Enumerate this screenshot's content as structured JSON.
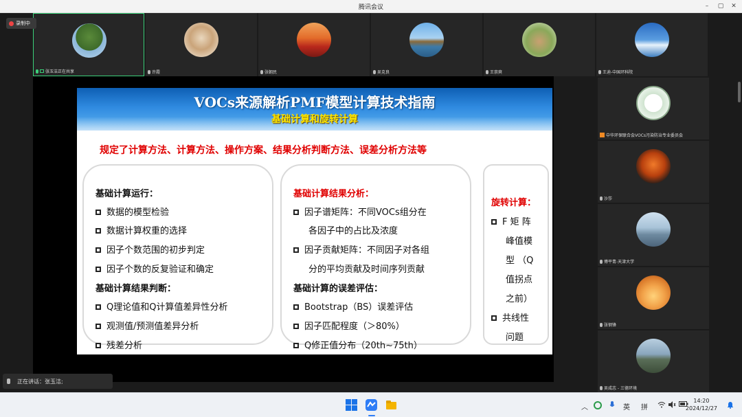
{
  "window": {
    "title": "腾讯会议",
    "minimize": "–",
    "maximize": "▢",
    "close": "✕"
  },
  "recording": {
    "label": "录制中"
  },
  "participants_top": [
    {
      "name": "张玉洁正在共享"
    },
    {
      "name": "许霞"
    },
    {
      "name": "张朝民"
    },
    {
      "name": "吴克良"
    },
    {
      "name": "王崇爽"
    },
    {
      "name": "王迪-中国环科院"
    }
  ],
  "participants_right": [
    {
      "name": "中华环保联合会VOCs污染防治专业委员会"
    },
    {
      "name": "沙莎"
    },
    {
      "name": "傅平青-天津大学"
    },
    {
      "name": "张钢锋"
    },
    {
      "name": "吴成志 - 三德环境"
    }
  ],
  "slide": {
    "title": "VOCs来源解析PMF模型计算技术指南",
    "subtitle": "基础计算和旋转计算",
    "subhead": "规定了计算方法、计算方法、操作方案、结果分析判断方法、误差分析方法等",
    "box1": {
      "head1": "基础计算运行：",
      "items1": [
        "数据的模型检验",
        "数据计算权重的选择",
        "因子个数范围的初步判定",
        "因子个数的反复验证和确定"
      ],
      "head2": "基础计算结果判断：",
      "items2": [
        "Q理论值和Q计算值差异性分析",
        "观测值/预测值差异分析",
        "残差分析"
      ]
    },
    "box2": {
      "head1": "基础计算结果分析：",
      "item1_l1": "因子谱矩阵：不同VOCs组分在",
      "item1_l2": "各因子中的占比及浓度",
      "item2_l1": "因子贡献矩阵：不同因子对各组",
      "item2_l2": "分的平均贡献及时间序列贡献",
      "head2": "基础计算的误差评估：",
      "items3": [
        "Bootstrap（BS）误差评估",
        "因子匹配程度（＞80%）",
        "Q修正值分布（20th~75th）"
      ]
    },
    "box3": {
      "head": "旋转计算：",
      "item1_lines": [
        "F 矩 阵",
        "峰值模",
        "型 （Q",
        "值拐点",
        "之前）"
      ],
      "item2_lines": [
        "共线性",
        "问题"
      ]
    }
  },
  "speaker": {
    "label": "正在讲话：张玉洁;"
  },
  "taskbar": {
    "tray_caret": "︿",
    "ime_lang": "英",
    "ime_mode": "拼",
    "time": "14:20",
    "date": "2024/12/27"
  }
}
